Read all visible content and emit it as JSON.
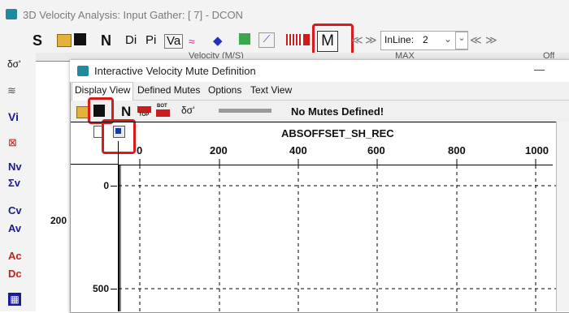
{
  "main_window": {
    "title": "3D Velocity Analysis: Input Gather: [ 7] - DCON",
    "toolbar": {
      "s_label": "S",
      "n_label": "N",
      "di_label": "Di",
      "pi_label": "Pi",
      "va_label": "Va",
      "m_label": "M",
      "inline_label": "InLine:",
      "inline_value": "2"
    },
    "header_fragment_velocity": "Velocity (M/S)",
    "header_fragment_max": "MAX",
    "header_fragment_off": "Off",
    "left_axis_value": "200",
    "left_tools": [
      "Vi",
      "Nv",
      "Σv",
      "Cv",
      "Av",
      "Ac",
      "Dc"
    ]
  },
  "dialog": {
    "title": "Interactive Velocity Mute Definition",
    "minimize_glyph": "—",
    "tabs": [
      "Display View",
      "Defined Mutes",
      "Options",
      "Text View"
    ],
    "toolbar_n_label": "N",
    "top_label": "TOP",
    "bot_label": "BOT",
    "status": "No Mutes Defined!"
  },
  "plot": {
    "x_axis_title": "ABSOFFSET_SH_REC",
    "x_ticks": [
      "0",
      "200",
      "400",
      "600",
      "800",
      "1000"
    ],
    "y_ticks": [
      "0",
      "500"
    ]
  },
  "colors": {
    "highlight": "#d81b1b",
    "app_icon": "#1f8a9e",
    "tool_blue": "#1a1a99"
  }
}
